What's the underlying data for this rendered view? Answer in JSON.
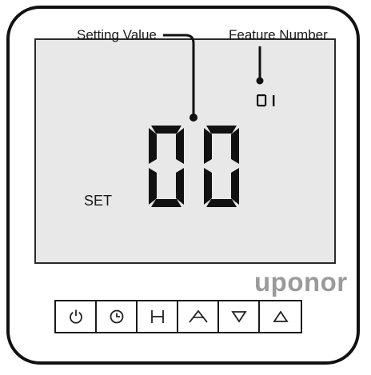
{
  "labels": {
    "setting_value": "Setting Value",
    "feature_number": "Feature Number",
    "set": "SET"
  },
  "display": {
    "main_digits": "00",
    "feature_digits": "01"
  },
  "brand": {
    "logo": "uponor"
  },
  "buttons": [
    {
      "icon": "power-icon"
    },
    {
      "icon": "clock-icon"
    },
    {
      "icon": "h-icon"
    },
    {
      "icon": "caret-up-icon"
    },
    {
      "icon": "triangle-down-icon"
    },
    {
      "icon": "triangle-up-icon"
    }
  ]
}
